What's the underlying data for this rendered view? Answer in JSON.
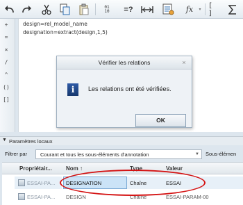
{
  "toolbar": {
    "icons": [
      "undo-icon",
      "redo-icon",
      "cut-icon",
      "copy-icon",
      "paste-icon",
      "binary-icon",
      "equals-query-icon",
      "measure-icon",
      "table-icon",
      "fx-icon",
      "brackets-icon",
      "sigma-icon"
    ],
    "fx_label": "fx",
    "binary_label": "01 10",
    "equals_label": "=?",
    "brackets_label": "[ ]"
  },
  "left_bar": {
    "symbols": [
      "+",
      "=",
      "×",
      "/",
      "^",
      "()",
      "[]"
    ]
  },
  "editor": {
    "lines": [
      "design=rel_model_name",
      "designation=extract(design,1,5)"
    ]
  },
  "dialog": {
    "title": "Vérifier les relations",
    "close": "×",
    "info_symbol": "i",
    "message": "Les relations ont été vérifiées.",
    "ok_label": "OK"
  },
  "params_panel": {
    "arrow": "▼",
    "label": "Paramètres locaux",
    "filter_label": "Filtrer par",
    "filter_value": "Courant et tous les sous-éléments d'annotation",
    "filter_arrow": "▼",
    "sub_label": "Sous-élémen"
  },
  "table": {
    "headers": [
      "Propriétair...",
      "Nom ↑",
      "Type",
      "Valeur"
    ],
    "rows": [
      {
        "owner": "ESSAI-PA...",
        "name": "DESIGNATION",
        "type": "Chaîne",
        "value": "ESSAI",
        "selected": true
      },
      {
        "owner": "ESSAI-PA...",
        "name": "DESIGN",
        "type": "Chaîne",
        "value": "ESSAI-PARAM-00",
        "selected": false
      }
    ]
  },
  "colors": {
    "accent": "#1c4a94",
    "highlight_row": "#cbe3f7",
    "annotation": "#d41313"
  }
}
